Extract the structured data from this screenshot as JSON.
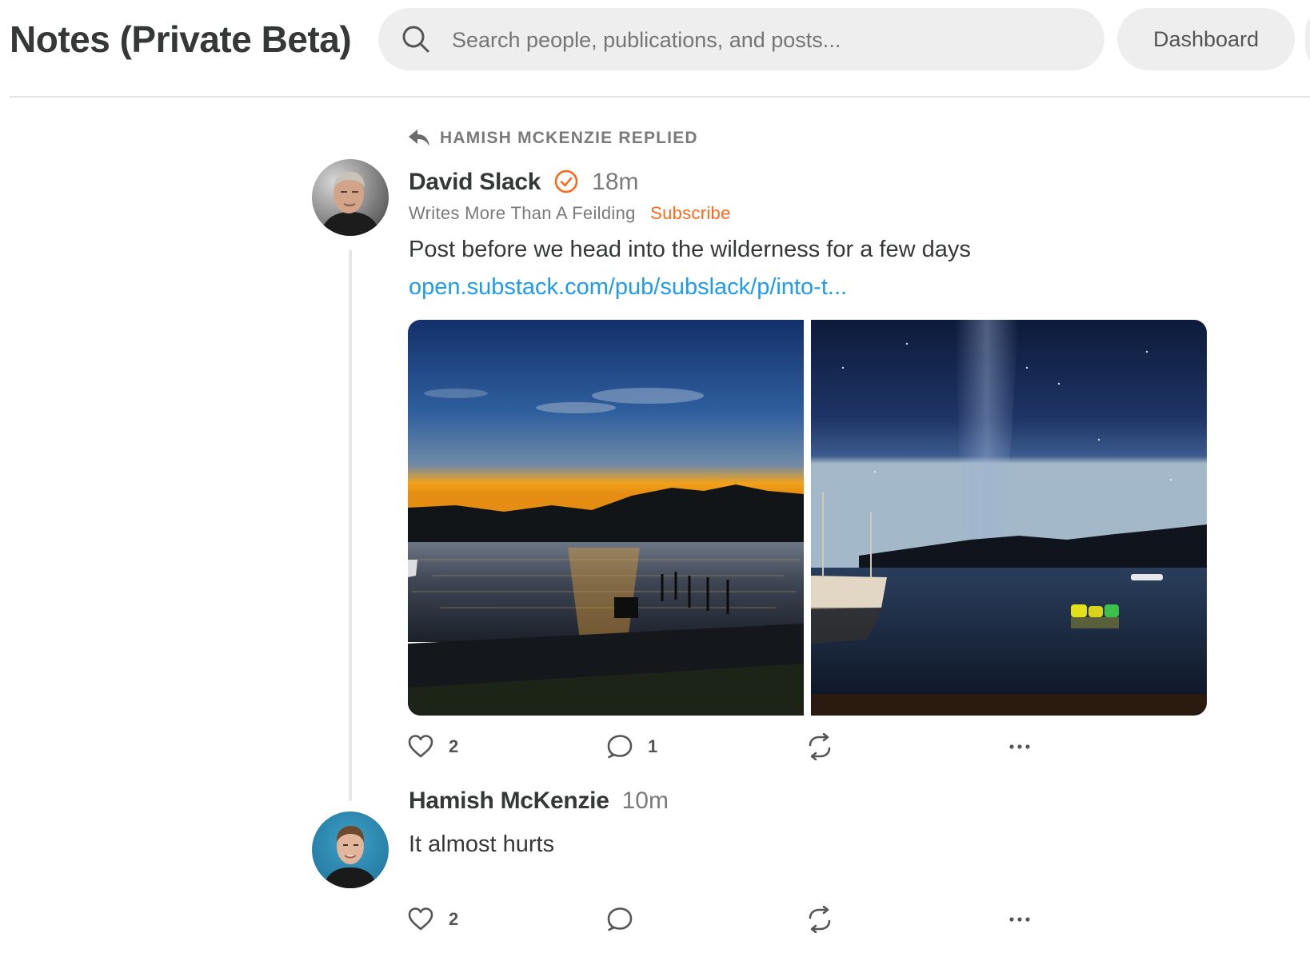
{
  "header": {
    "title": "Notes (Private Beta)",
    "search": {
      "placeholder": "Search people, publications, and posts..."
    },
    "dashboard_label": "Dashboard"
  },
  "reply_context": {
    "icon": "reply-icon",
    "text": "HAMISH MCKENZIE REPLIED"
  },
  "note": {
    "author": "David Slack",
    "verified_icon": "verified-badge-icon",
    "time": "18m",
    "publication": "Writes More Than A Feilding",
    "subscribe_label": "Subscribe",
    "text": "Post before we head into the wilderness for a few days",
    "link": "open.substack.com/pub/subslack/p/into-t...",
    "images": [
      "sunset over lake with mountains",
      "night harbour with boats"
    ],
    "actions": {
      "likes": "2",
      "comments": "1"
    }
  },
  "reply": {
    "author": "Hamish McKenzie",
    "time": "10m",
    "text": "It almost hurts",
    "actions": {
      "likes": "2"
    }
  },
  "colors": {
    "accent": "#ff6719",
    "link": "#1d9bf0",
    "text": "#363737",
    "muted": "#7a7a7a",
    "pill_bg": "#eeeeee"
  }
}
